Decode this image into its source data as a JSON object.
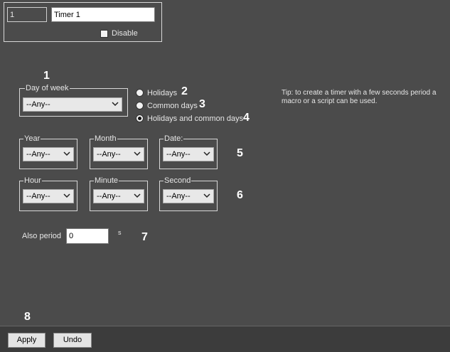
{
  "timer": {
    "id_value": "1",
    "name_value": "Timer 1",
    "disable_label": "Disable"
  },
  "day_of_week": {
    "label": "Day of week",
    "value": "--Any--"
  },
  "day_type": {
    "options": [
      {
        "label": "Holidays",
        "selected": false
      },
      {
        "label": "Common days",
        "selected": false
      },
      {
        "label": "Holidays and common days",
        "selected": true
      }
    ]
  },
  "tip": "Tip: to create a timer with a few seconds period a macro or a script can be used.",
  "date_fields": [
    {
      "label": "Year",
      "value": "--Any--"
    },
    {
      "label": "Month",
      "value": "--Any--"
    },
    {
      "label": "Date:",
      "value": "--Any--"
    }
  ],
  "time_fields": [
    {
      "label": "Hour",
      "value": "--Any--"
    },
    {
      "label": "Minute",
      "value": "--Any--"
    },
    {
      "label": "Second",
      "value": "--Any--"
    }
  ],
  "period": {
    "label": "Also period",
    "value": "0",
    "unit": "s"
  },
  "markers": [
    "1",
    "2",
    "3",
    "4",
    "5",
    "6",
    "7",
    "8"
  ],
  "buttons": {
    "apply": "Apply",
    "undo": "Undo"
  }
}
